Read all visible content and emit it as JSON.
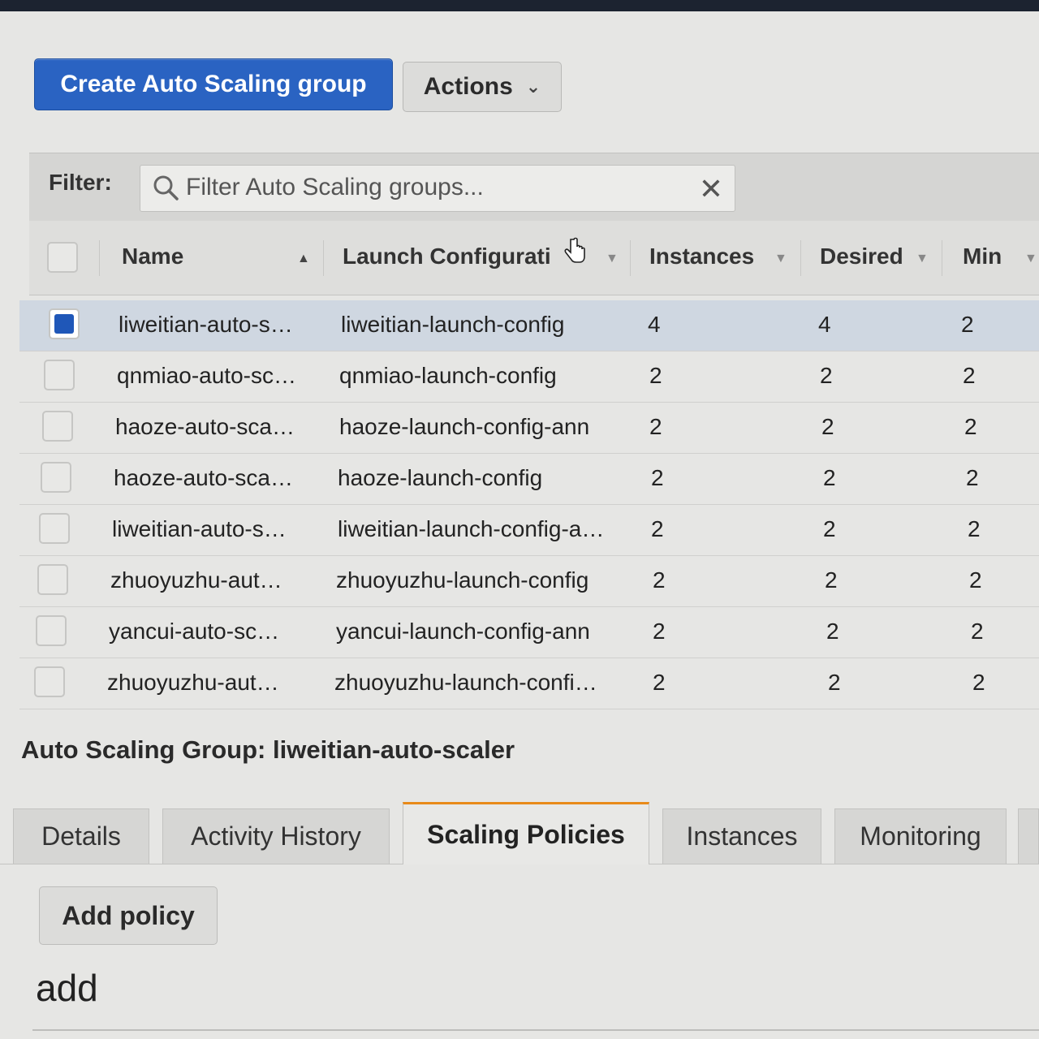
{
  "toolbar": {
    "create_label": "Create Auto Scaling group",
    "actions_label": "Actions"
  },
  "filter": {
    "label": "Filter:",
    "placeholder": "Filter Auto Scaling groups..."
  },
  "table": {
    "columns": [
      "Name",
      "Launch Configurati",
      "Instances",
      "Desired",
      "Min"
    ],
    "rows": [
      {
        "name": "liweitian-auto-s…",
        "launch_config": "liweitian-launch-config",
        "instances": "4",
        "desired": "4",
        "min": "2",
        "selected": true
      },
      {
        "name": "qnmiao-auto-sc…",
        "launch_config": "qnmiao-launch-config",
        "instances": "2",
        "desired": "2",
        "min": "2",
        "selected": false
      },
      {
        "name": "haoze-auto-sca…",
        "launch_config": "haoze-launch-config-ann",
        "instances": "2",
        "desired": "2",
        "min": "2",
        "selected": false
      },
      {
        "name": "haoze-auto-sca…",
        "launch_config": "haoze-launch-config",
        "instances": "2",
        "desired": "2",
        "min": "2",
        "selected": false
      },
      {
        "name": "liweitian-auto-s…",
        "launch_config": "liweitian-launch-config-a…",
        "instances": "2",
        "desired": "2",
        "min": "2",
        "selected": false
      },
      {
        "name": "zhuoyuzhu-aut…",
        "launch_config": "zhuoyuzhu-launch-config",
        "instances": "2",
        "desired": "2",
        "min": "2",
        "selected": false
      },
      {
        "name": "yancui-auto-sc…",
        "launch_config": "yancui-launch-config-ann",
        "instances": "2",
        "desired": "2",
        "min": "2",
        "selected": false
      },
      {
        "name": "zhuoyuzhu-aut…",
        "launch_config": "zhuoyuzhu-launch-confi…",
        "instances": "2",
        "desired": "2",
        "min": "2",
        "selected": false
      }
    ]
  },
  "detail": {
    "title": "Auto Scaling Group: liweitian-auto-scaler",
    "tabs": [
      "Details",
      "Activity History",
      "Scaling Policies",
      "Instances",
      "Monitoring"
    ],
    "active_tab": "Scaling Policies",
    "add_policy_label": "Add policy",
    "input_text": "add"
  },
  "colors": {
    "primary": "#2a63c2",
    "active_tab_accent": "#e88a1a",
    "selected_row": "#cfd7e1"
  }
}
